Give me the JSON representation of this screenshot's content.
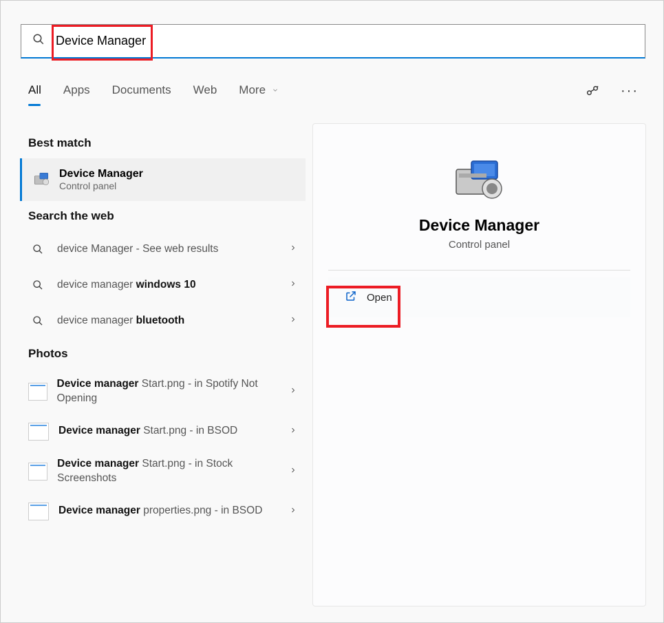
{
  "search": {
    "value": "Device Manager"
  },
  "tabs": {
    "all": "All",
    "apps": "Apps",
    "documents": "Documents",
    "web": "Web",
    "more": "More"
  },
  "sections": {
    "best_match": "Best match",
    "search_web": "Search the web",
    "photos": "Photos"
  },
  "best_match": {
    "title": "Device Manager",
    "subtitle": "Control panel"
  },
  "web_results": [
    {
      "prefix": "device Manager",
      "bold": "",
      "suffix": " - See web results"
    },
    {
      "prefix": "device manager ",
      "bold": "windows 10",
      "suffix": ""
    },
    {
      "prefix": "device manager ",
      "bold": "bluetooth",
      "suffix": ""
    }
  ],
  "photos": [
    {
      "title_bold": "Device manager",
      "title_rest": " Start.png",
      "sub": " - in Spotify Not Opening"
    },
    {
      "title_bold": "Device manager",
      "title_rest": " Start.png",
      "sub": " - in BSOD"
    },
    {
      "title_bold": "Device manager",
      "title_rest": " Start.png",
      "sub": " - in Stock Screenshots"
    },
    {
      "title_bold": "Device manager",
      "title_rest": " properties.png",
      "sub": " - in BSOD"
    }
  ],
  "preview": {
    "title": "Device Manager",
    "subtitle": "Control panel",
    "open": "Open"
  }
}
